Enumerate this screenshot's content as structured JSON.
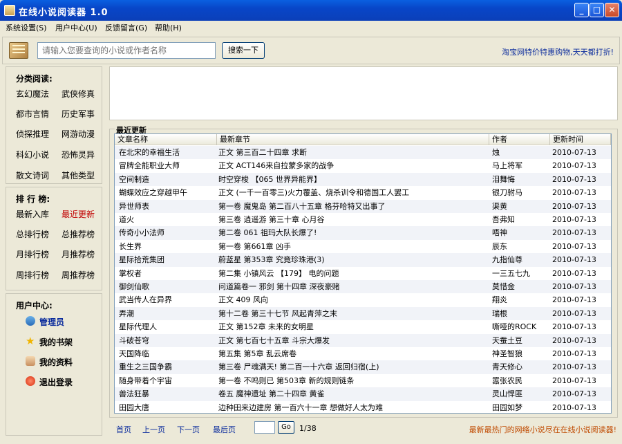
{
  "window": {
    "title": "在线小说阅读器 1.0",
    "controls": {
      "minimize": "_",
      "maximize": "□",
      "close": "✕"
    }
  },
  "menu": [
    {
      "label": "系统设置(S)"
    },
    {
      "label": "用户中心(U)"
    },
    {
      "label": "反馈留言(G)"
    },
    {
      "label": "帮助(H)"
    }
  ],
  "search": {
    "placeholder": "请输入您要查询的小说或作者名称",
    "button_label": "搜索一下",
    "ad_text": "淘宝网特价特惠购物,天天都打折!"
  },
  "categories": {
    "title": "分类阅读:",
    "items": [
      "玄幻魔法",
      "武侠修真",
      "都市言情",
      "历史军事",
      "侦探推理",
      "网游动漫",
      "科幻小说",
      "恐怖灵异",
      "散文诗词",
      "其他类型"
    ]
  },
  "rankings": {
    "title": "排 行 榜:",
    "items": [
      "最新入库",
      "最近更新",
      "总排行榜",
      "总推荐榜",
      "月排行榜",
      "月推荐榜",
      "周排行榜",
      "周推荐榜"
    ],
    "active_index": 1
  },
  "user_center": {
    "title": "用户中心:",
    "items": [
      {
        "label": "管理员",
        "icon": "admin-user-icon"
      },
      {
        "label": "我的书架",
        "icon": "star-icon"
      },
      {
        "label": "我的资料",
        "icon": "profile-icon"
      },
      {
        "label": "退出登录",
        "icon": "logout-icon"
      }
    ]
  },
  "recent": {
    "title": "最近更新",
    "columns": [
      "文章名称",
      "最新章节",
      "作者",
      "更新时间"
    ],
    "rows": [
      [
        "在北宋的幸福生活",
        "正文 第三百二十四章 求断",
        "烛",
        "2010-07-13"
      ],
      [
        "冒牌全能职业大师",
        "正文 ACT146来自拉蒙多家的战争",
        "马上将军",
        "2010-07-13"
      ],
      [
        "空间制造",
        "时空穿梭 【065 世界异能界】",
        "泪舞悔",
        "2010-07-13"
      ],
      [
        "蝴蝶效应之穿越甲午",
        "正文 (一千一百零三)火力覆盖、烧杀训令和德国工人罢工",
        "银刀驸马",
        "2010-07-13"
      ],
      [
        "异世师表",
        "第一卷 魔鬼岛 第二百八十五章 格芬哈特又出事了",
        "渠黄",
        "2010-07-13"
      ],
      [
        "道火",
        "第三卷 逍遥游 第三十章 心月谷",
        "吾弗知",
        "2010-07-13"
      ],
      [
        "传奇小小法师",
        "第二卷 061 祖玛大队长爆了!",
        "唔神",
        "2010-07-13"
      ],
      [
        "长生界",
        "第一卷 第661章 凶手",
        "辰东",
        "2010-07-13"
      ],
      [
        "星际拾荒集团",
        "蔚蓝星 第353章 究竟珍珠港(3)",
        "九指仙尊",
        "2010-07-13"
      ],
      [
        "掌权者",
        "第二集 小镇风云 【179】 电的问题",
        "一三五七九",
        "2010-07-13"
      ],
      [
        "御剑仙歌",
        "问道篇卷一 邪剑 第十四章 深夜豪赌",
        "莫惜金",
        "2010-07-13"
      ],
      [
        "武当传人在异界",
        "正文 409 风向",
        "翔炎",
        "2010-07-13"
      ],
      [
        "弄潮",
        "第十二卷 第三十七节 风起青萍之末",
        "瑞根",
        "2010-07-13"
      ],
      [
        "星际代理人",
        "正文 第152章 未来的女明星",
        "嘶哑的ROCK",
        "2010-07-13"
      ],
      [
        "斗破苍穹",
        "正文 第七百七十五章 斗宗大爆发",
        "天蚕土豆",
        "2010-07-13"
      ],
      [
        "天国降临",
        "第五集 第5章 乱云席卷",
        "神圣智狼",
        "2010-07-13"
      ],
      [
        "重生之三国争霸",
        "第三卷 尸魂满天! 第二百一十六章 返回归宿(上)",
        "青天修心",
        "2010-07-13"
      ],
      [
        "随身带着个宇宙",
        "第一卷 不鸣则已 第503章 新的规则链条",
        "嚣张农民",
        "2010-07-13"
      ],
      [
        "兽法狂暴",
        "卷五 魔神遗址 第二十四章 黄雀",
        "灵山悍匪",
        "2010-07-13"
      ],
      [
        "田园大唐",
        "边种田来边建房 第一百六十一章 想做好人太为难",
        "田园如梦",
        "2010-07-13"
      ]
    ]
  },
  "pager": {
    "first": "首页",
    "prev": "上一页",
    "next": "下一页",
    "last": "最后页",
    "go_label": "Go",
    "page_count": "1/38",
    "promo": "最新最热门的网络小说尽在在线小说阅读器!"
  },
  "colors": {
    "titlebar": "#0846c8",
    "link": "#0a2b9c",
    "active": "#c00000",
    "promo": "#c04a00"
  }
}
